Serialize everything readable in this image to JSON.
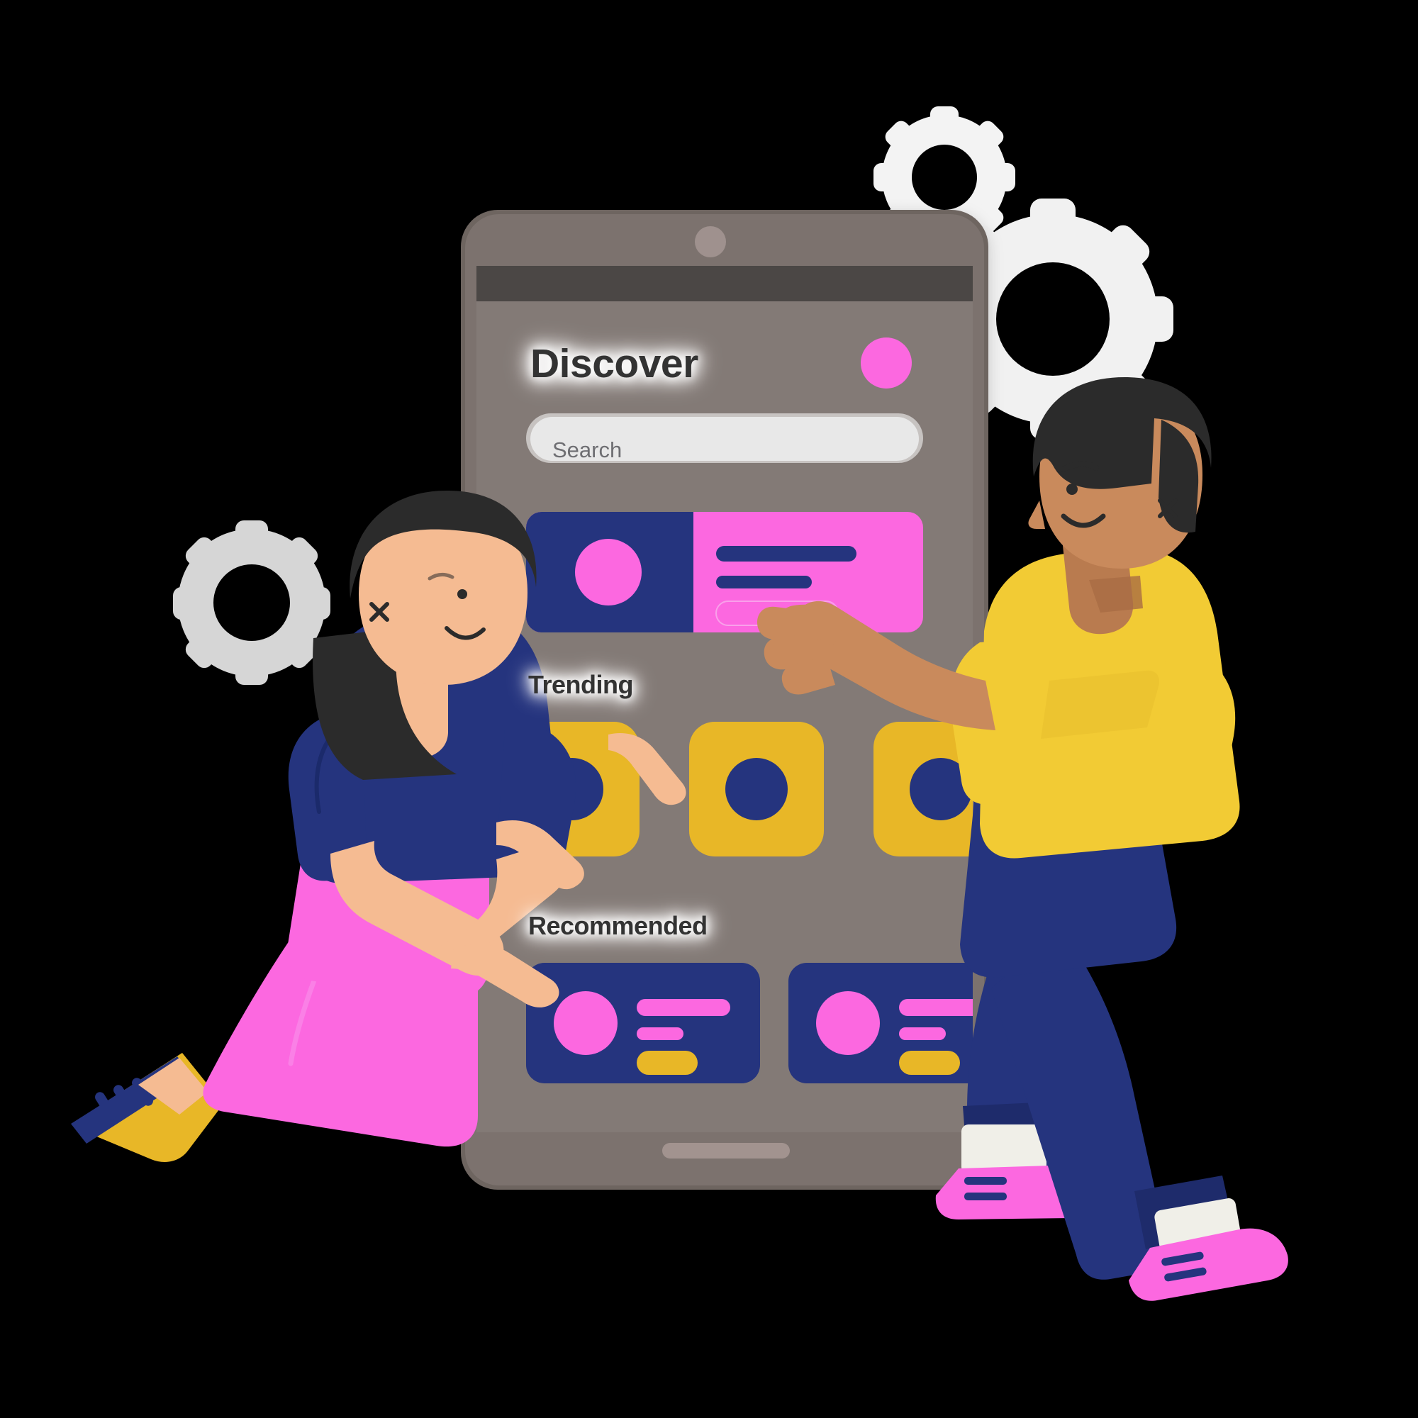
{
  "scene": {
    "kind": "illustration",
    "description": "Two people assembling a mobile app discovery screen",
    "background_color": "#000000"
  },
  "device": {
    "name": "smartphone-mockup",
    "frame_color": "#7b726e",
    "frame_edge_color": "#6a615e",
    "screen_color": "#837a76",
    "status_bar_color": "#4b4644",
    "camera_color": "#9f918e",
    "home_indicator_color": "#a2938f"
  },
  "app": {
    "header": {
      "title": "Discover",
      "title_color": "#333333",
      "avatar": {
        "name": "profile-avatar",
        "color": "#fc68e0"
      }
    },
    "search": {
      "placeholder": "Search",
      "value": "",
      "field_color": "#e8e8e8",
      "text_color": "#6e6e72"
    },
    "featured_card": {
      "name": "featured-card",
      "left_panel_color": "#25347e",
      "right_panel_color": "#fc68e0",
      "thumb_color": "#fc68e0",
      "line_color": "#25347e",
      "lines": [
        {
          "width": 198,
          "kind": "title-bar"
        },
        {
          "width": 135,
          "kind": "subtitle-bar"
        },
        {
          "width": 172,
          "kind": "button-bar"
        }
      ]
    },
    "sections": [
      {
        "id": "trending",
        "label": "Trending",
        "label_color": "#333333",
        "card_color": "#e8b727",
        "dot_color": "#25347e",
        "items": [
          {
            "name": "trending-card-1"
          },
          {
            "name": "trending-card-2"
          },
          {
            "name": "trending-card-3"
          }
        ]
      },
      {
        "id": "recommended",
        "label": "Recommended",
        "label_color": "#333333",
        "card_color": "#25347e",
        "avatar_color": "#fc68e0",
        "line_color": "#fc68e0",
        "button_color": "#e8b727",
        "items": [
          {
            "name": "recommended-card-1"
          },
          {
            "name": "recommended-card-2"
          }
        ]
      }
    ]
  },
  "decorations": {
    "gears": [
      {
        "name": "gear-small-top",
        "color": "#f3f3f3"
      },
      {
        "name": "gear-large-right",
        "color": "#f1f1f1"
      },
      {
        "name": "gear-left-behind",
        "color": "#e6e6e6"
      }
    ]
  },
  "characters": [
    {
      "name": "woman-kneeling",
      "hair_color": "#2b2b2b",
      "skin_color": "#f5bb92",
      "shirt_color": "#25347e",
      "pants_color": "#fc68e0",
      "shoe_color": "#e8b727",
      "shoe_accent_color": "#25347e"
    },
    {
      "name": "man-walking",
      "hair_color": "#2b2b2b",
      "skin_color": "#c98a5c",
      "shirt_color": "#f2cb34",
      "pants_color": "#25347e",
      "shoe_color": "#fc68e0",
      "shoe_accent_color": "#25347e",
      "sock_color": "#f0efe8"
    }
  ],
  "palette": {
    "navy": "#25347e",
    "pink": "#fc68e0",
    "yellow": "#e8b727",
    "yellow_shirt": "#f2cb34",
    "grey_frame": "#7b726e",
    "grey_screen": "#837a76",
    "dark_text": "#333333",
    "white": "#ffffff"
  }
}
